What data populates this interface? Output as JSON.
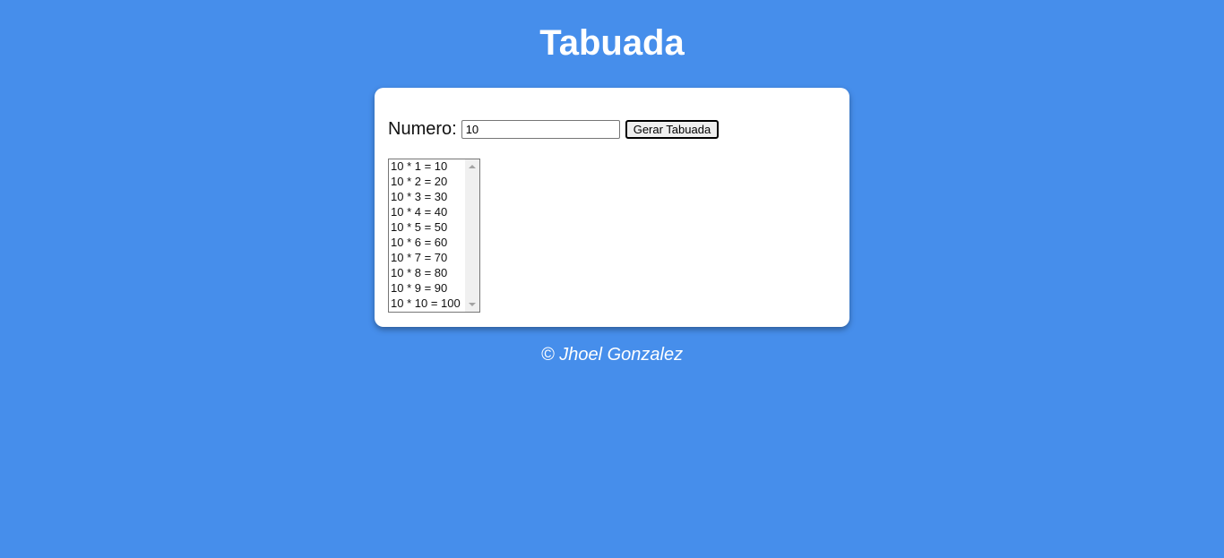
{
  "header": {
    "title": "Tabuada"
  },
  "form": {
    "label": "Numero:",
    "input_value": "10",
    "button_label": "Gerar Tabuada"
  },
  "results": {
    "items": [
      "10 * 1 = 10",
      "10 * 2 = 20",
      "10 * 3 = 30",
      "10 * 4 = 40",
      "10 * 5 = 50",
      "10 * 6 = 60",
      "10 * 7 = 70",
      "10 * 8 = 80",
      "10 * 9 = 90",
      "10 * 10 = 100"
    ]
  },
  "footer": {
    "text": "© Jhoel Gonzalez"
  },
  "colors": {
    "background": "#468eeb",
    "card": "#ffffff",
    "text_light": "#ffffff"
  },
  "icons": {
    "scroll_up": "triangle-up-icon",
    "scroll_down": "triangle-down-icon"
  }
}
